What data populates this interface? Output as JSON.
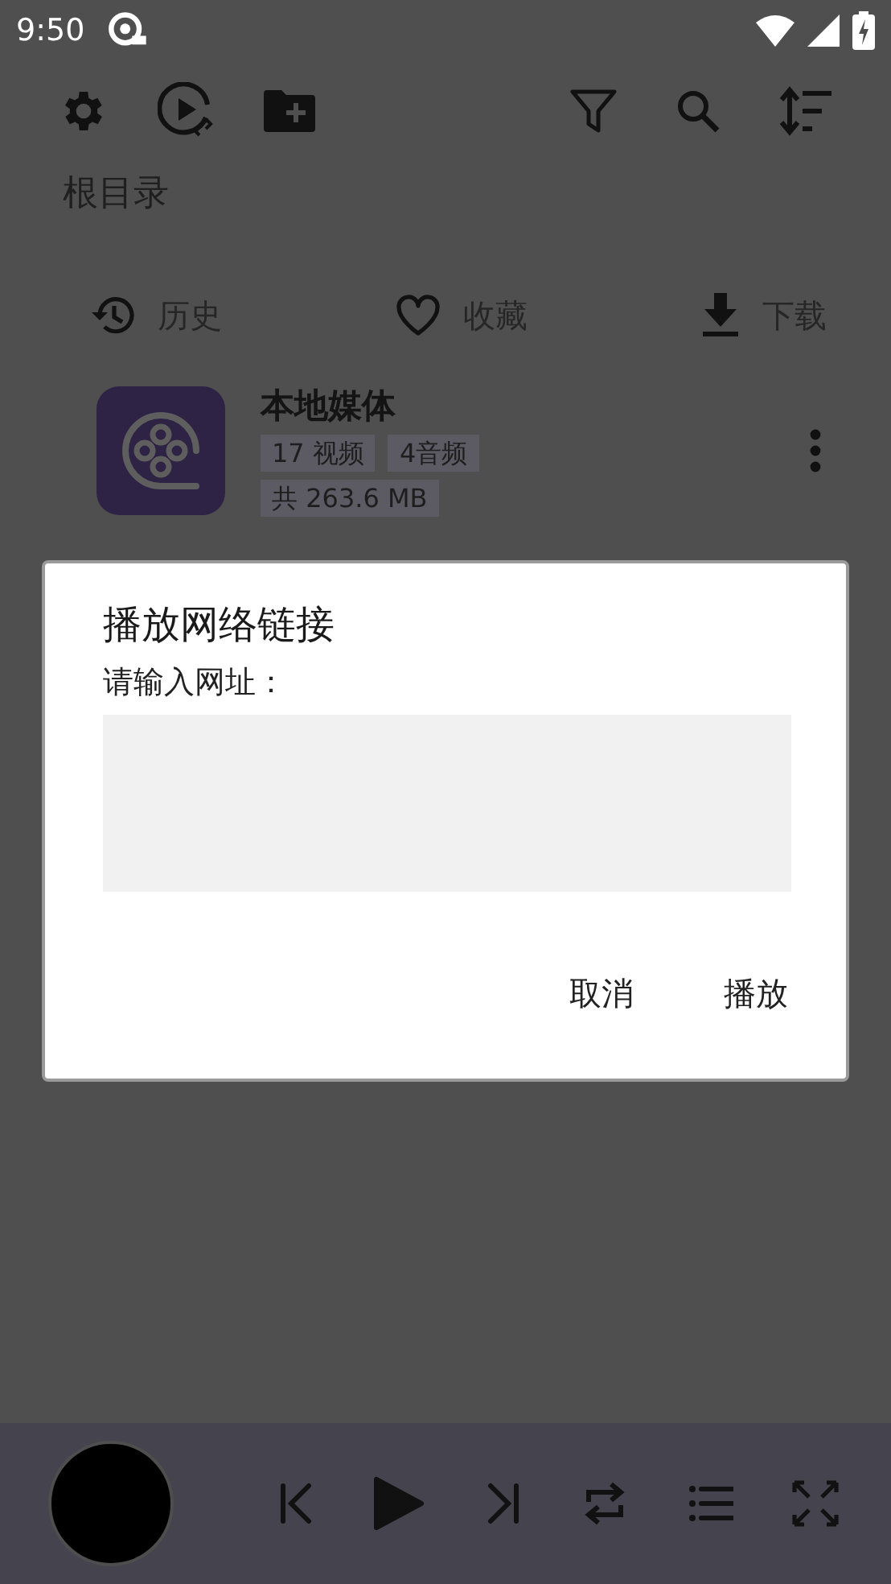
{
  "status_bar": {
    "time": "9:50"
  },
  "breadcrumb": "根目录",
  "shortcuts": [
    {
      "label": "历史",
      "kind": "history"
    },
    {
      "label": "收藏",
      "kind": "favorite"
    },
    {
      "label": "下载",
      "kind": "download"
    }
  ],
  "media_items": [
    {
      "title": "本地媒体",
      "tag_rows": [
        [
          "17 视频",
          "4音频"
        ],
        [
          "共 263.6 MB"
        ]
      ]
    }
  ],
  "dialog": {
    "title": "播放网络链接",
    "prompt": "请输入网址：",
    "buttons": [
      "取消",
      "播放"
    ]
  },
  "player": {
    "playing": false
  }
}
